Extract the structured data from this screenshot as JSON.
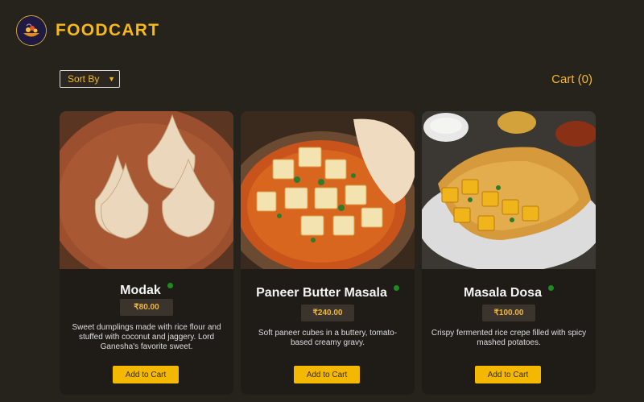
{
  "brand": {
    "name": "FOODCART"
  },
  "toolbar": {
    "sort_label": "Sort By",
    "cart_label": "Cart (0)"
  },
  "products": [
    {
      "name": "Modak",
      "price": "₹80.00",
      "description": "Sweet dumplings made with rice flour and stuffed with coconut and jaggery. Lord Ganesha's favorite sweet.",
      "button": "Add to Cart"
    },
    {
      "name": "Paneer Butter Masala",
      "price": "₹240.00",
      "description": "Soft paneer cubes in a buttery, tomato-based creamy gravy.",
      "button": "Add to Cart"
    },
    {
      "name": "Masala Dosa",
      "price": "₹100.00",
      "description": "Crispy fermented rice crepe filled with spicy mashed potatoes.",
      "button": "Add to Cart"
    }
  ],
  "colors": {
    "background": "#26221c",
    "accent": "#f6b81c",
    "card": "#1f1c18",
    "veg_indicator": "#1a8d1a"
  }
}
